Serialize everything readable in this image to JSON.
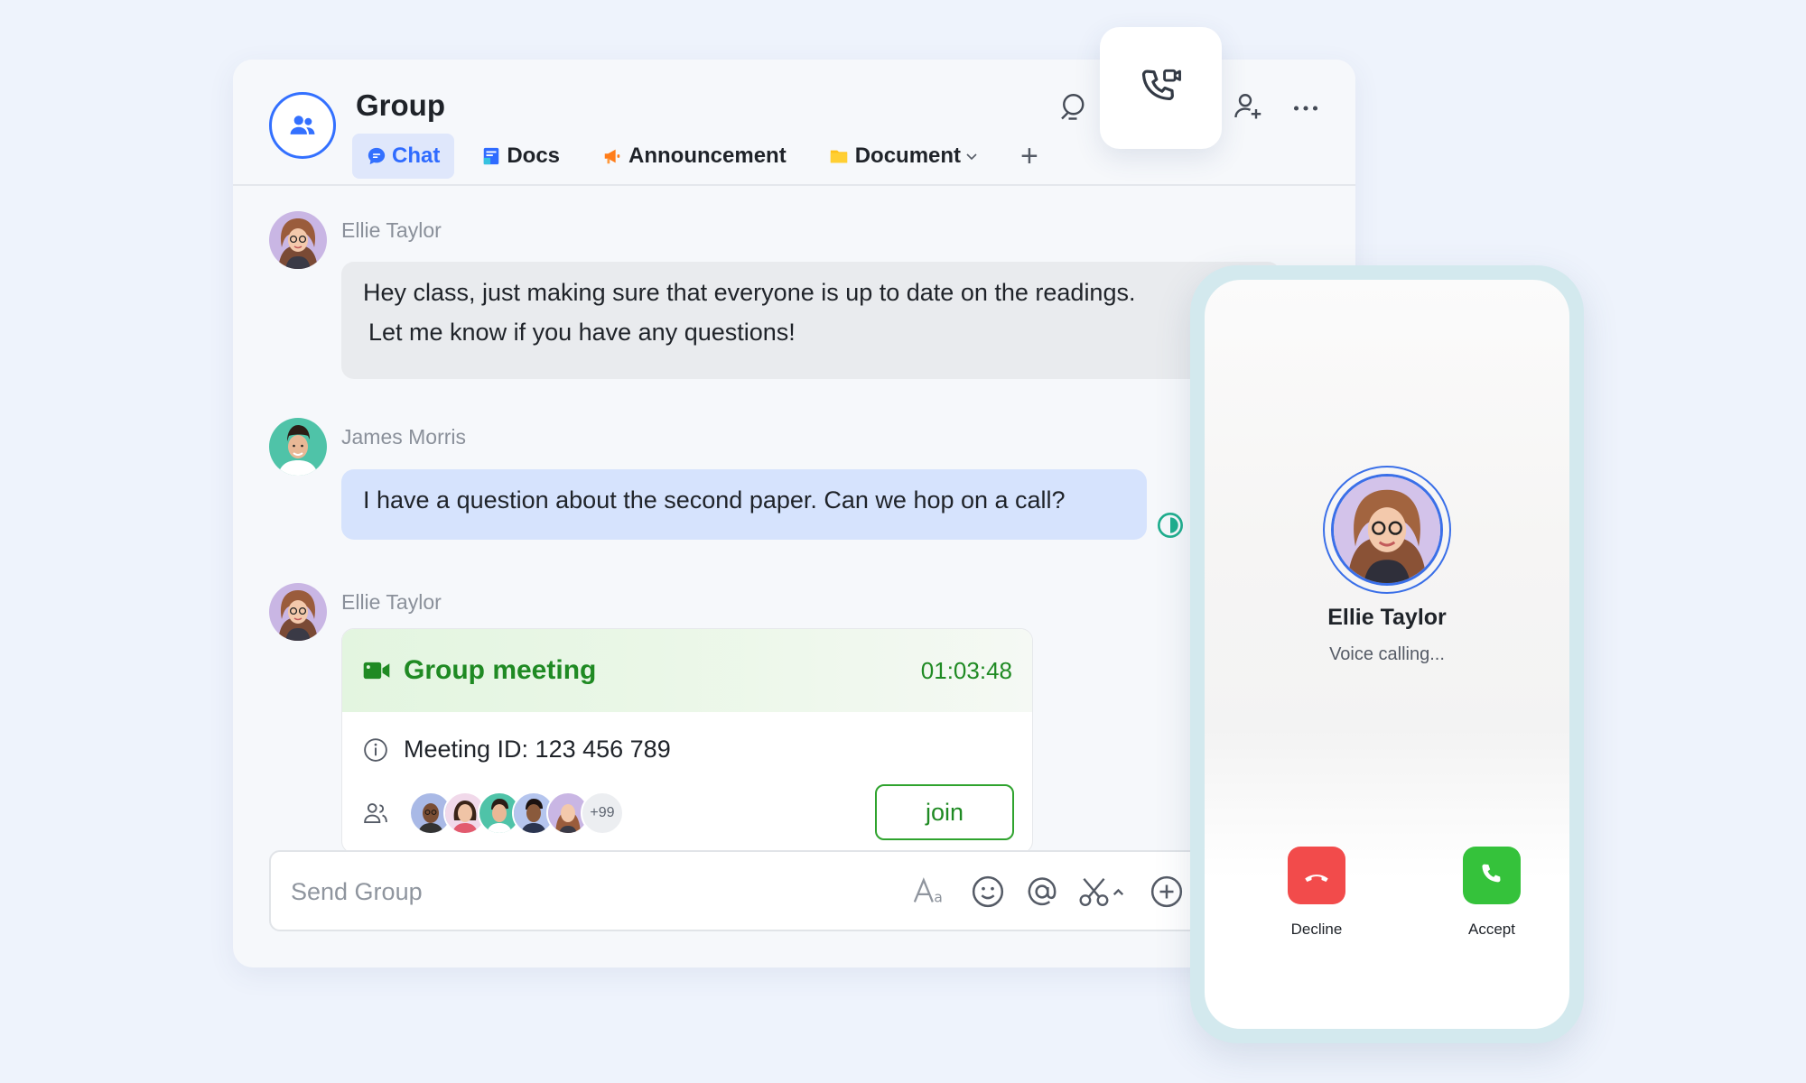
{
  "header": {
    "title": "Group",
    "tabs": [
      {
        "label": "Chat",
        "icon": "chat-bubble-icon",
        "active": true
      },
      {
        "label": "Docs",
        "icon": "docs-icon"
      },
      {
        "label": "Announcement",
        "icon": "megaphone-icon"
      },
      {
        "label": "Document",
        "icon": "folder-icon",
        "has_dropdown": true
      }
    ],
    "add_tab_label": "+"
  },
  "messages": [
    {
      "sender": "Ellie Taylor",
      "text": "Hey class, just making sure that everyone is up to date on the readings.",
      "text2": "Let me know if you have any questions!",
      "style": "grey"
    },
    {
      "sender": "James Morris",
      "text": "I have a question about the second paper. Can we hop on a call?",
      "style": "blue"
    },
    {
      "sender": "Ellie Taylor",
      "type": "meeting-card"
    }
  ],
  "meeting": {
    "title": "Group meeting",
    "duration": "01:03:48",
    "meeting_id": "Meeting ID: 123 456 789",
    "more_participants": "+99",
    "join_label": "join"
  },
  "composer": {
    "placeholder": "Send Group",
    "tools": [
      "text-format-icon",
      "emoji-icon",
      "mention-icon",
      "screenshot-icon",
      "add-circle-icon"
    ]
  },
  "phone": {
    "caller_name": "Ellie Taylor",
    "status": "Voice calling...",
    "decline_label": "Decline",
    "accept_label": "Accept"
  },
  "colors": {
    "accent": "#3370ff",
    "meeting_green": "#1f8a23",
    "decline_red": "#f24b4b",
    "accept_green": "#35c23b",
    "sent_bubble": "#d6e3fd",
    "received_bubble": "#e9ebee"
  }
}
